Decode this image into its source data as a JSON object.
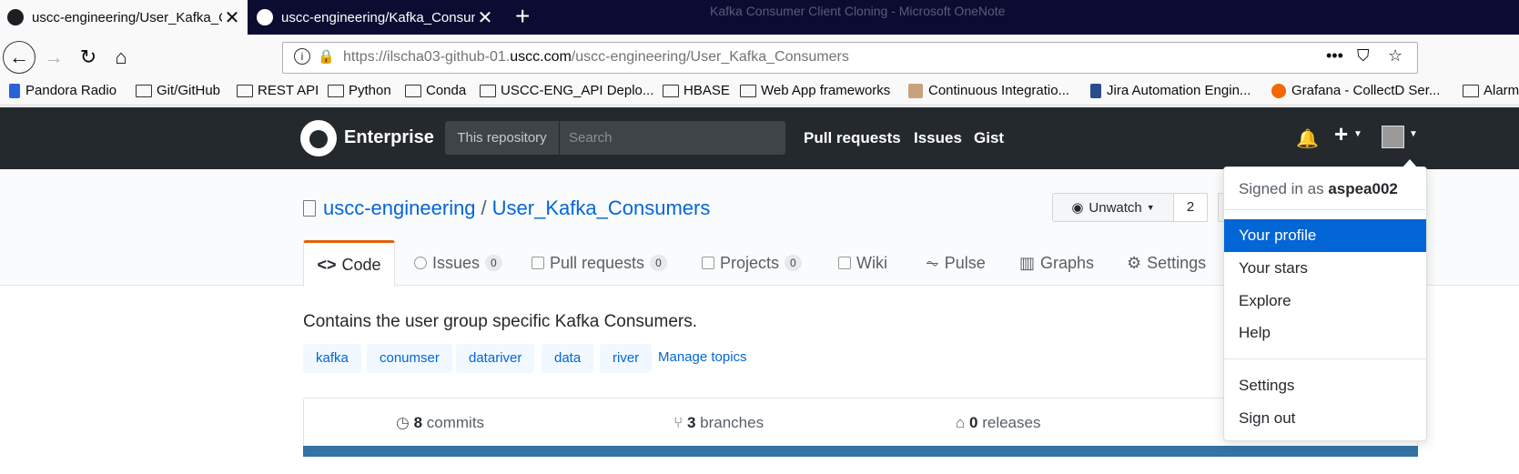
{
  "browser": {
    "background_title": "Kafka Consumer Client Cloning - Microsoft OneNote",
    "tabs": [
      {
        "title": "uscc-engineering/User_Kafka_C",
        "active": true
      },
      {
        "title": "uscc-engineering/Kafka_Consum",
        "active": false
      }
    ],
    "new_tab_label": "+",
    "url_host_prefix": "https://ilscha03-github-01.",
    "url_host_domain": "uscc.com",
    "url_path": "/uscc-engineering/User_Kafka_Consumers",
    "bookmarks": [
      {
        "label": "Pandora Radio",
        "icon": "pandora-icon"
      },
      {
        "label": "Git/GitHub",
        "icon": "folder-icon"
      },
      {
        "label": "REST API",
        "icon": "folder-icon"
      },
      {
        "label": "Python",
        "icon": "folder-icon"
      },
      {
        "label": "Conda",
        "icon": "folder-icon"
      },
      {
        "label": "USCC-ENG_API Deplo...",
        "icon": "folder-icon"
      },
      {
        "label": "HBASE",
        "icon": "folder-icon"
      },
      {
        "label": "Web App frameworks",
        "icon": "folder-icon"
      },
      {
        "label": "Continuous Integratio...",
        "icon": "jenkins-icon"
      },
      {
        "label": "Jira Automation Engin...",
        "icon": "jira-icon"
      },
      {
        "label": "Grafana - CollectD Ser...",
        "icon": "grafana-icon"
      },
      {
        "label": "Alarm",
        "icon": "folder-icon"
      }
    ]
  },
  "github": {
    "brand": "Enterprise",
    "scope_label": "This repository",
    "search_placeholder": "Search",
    "nav": [
      "Pull requests",
      "Issues",
      "Gist"
    ],
    "new_label": "+",
    "repo": {
      "owner": "uscc-engineering",
      "separator": "/",
      "name": "User_Kafka_Consumers",
      "watch_label": "Unwatch",
      "watch_count": "2",
      "tabs": [
        {
          "label": "Code",
          "count": null,
          "icon": "code-icon"
        },
        {
          "label": "Issues",
          "count": "0",
          "icon": "issue-icon"
        },
        {
          "label": "Pull requests",
          "count": "0",
          "icon": "pull-request-icon"
        },
        {
          "label": "Projects",
          "count": "0",
          "icon": "project-icon"
        },
        {
          "label": "Wiki",
          "count": null,
          "icon": "book-icon"
        },
        {
          "label": "Pulse",
          "count": null,
          "icon": "pulse-icon"
        },
        {
          "label": "Graphs",
          "count": null,
          "icon": "graph-icon"
        },
        {
          "label": "Settings",
          "count": null,
          "icon": "gear-icon"
        }
      ],
      "description": "Contains the user group specific Kafka Consumers.",
      "topics": [
        "kafka",
        "conumser",
        "datariver",
        "data",
        "river"
      ],
      "manage_topics": "Manage topics",
      "summary": {
        "commits_num": "8",
        "commits_label": "commits",
        "branches_num": "3",
        "branches_label": "branches",
        "releases_num": "0",
        "releases_label": "releases"
      },
      "language_color": "#3572a5"
    },
    "user_menu": {
      "signed_in_prefix": "Signed in as",
      "username": "aspea002",
      "items_top": [
        "Your profile",
        "Your stars",
        "Explore",
        "Help"
      ],
      "items_bottom": [
        "Settings",
        "Sign out"
      ],
      "highlighted": "Your profile"
    }
  },
  "colors": {
    "accent": "#0366d6",
    "header_bg": "#24292e",
    "tab_underline": "#e36209"
  }
}
